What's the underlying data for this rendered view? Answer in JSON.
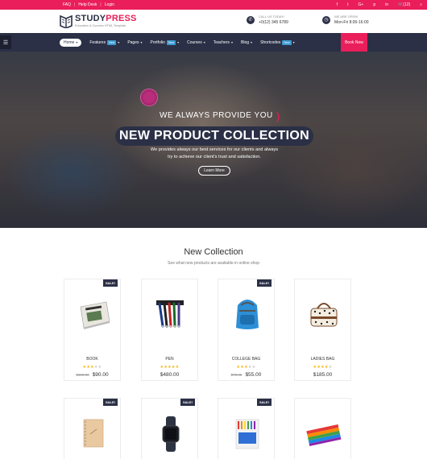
{
  "topbar": {
    "links": [
      "FAQ",
      "Help Desk",
      "Login"
    ],
    "social_icons": [
      "facebook-icon",
      "twitter-icon",
      "google-plus-icon",
      "pinterest-icon",
      "linkedin-icon",
      "cart-icon",
      "search-icon"
    ],
    "cart_count": "(12)"
  },
  "header": {
    "logo_study": "STUDY",
    "logo_press": "PRESS",
    "logo_tagline": "Education & Courses HTML Template",
    "contact_call_label": "CALL US TODAY!",
    "contact_call_value": "+0(12) 345 6789",
    "contact_open_label": "WE ARE OPEN!",
    "contact_open_value": "Mon-Fri 8:00-16:00"
  },
  "nav": {
    "items": [
      {
        "label": "Home",
        "badge": "",
        "caret": "▾"
      },
      {
        "label": "Features",
        "badge": "New",
        "caret": "▾"
      },
      {
        "label": "Pages",
        "badge": "",
        "caret": "▾"
      },
      {
        "label": "Portfolio",
        "badge": "New",
        "caret": "▾"
      },
      {
        "label": "Courses",
        "badge": "",
        "caret": "▾"
      },
      {
        "label": "Teachers",
        "badge": "",
        "caret": "▾"
      },
      {
        "label": "Blog",
        "badge": "",
        "caret": "▾"
      },
      {
        "label": "Shortcodes",
        "badge": "New",
        "caret": "▾"
      }
    ],
    "book_now": "Book Now"
  },
  "hero": {
    "subtitle": "WE ALWAYS PROVIDE YOU",
    "title": "NEW PRODUCT COLLECTION",
    "text_line1": "We provides always our best services for our clients and always",
    "text_line2": "try to achieve our client's trust and satisfaction.",
    "button": "Learn More"
  },
  "collection": {
    "title": "New Collection",
    "subtitle": "See what new products are available in online shop",
    "sale_label": "SALE!",
    "products": [
      {
        "name": "BOOK",
        "old_price": "$150.00",
        "price": "$90.00",
        "rating": 3,
        "sale": true
      },
      {
        "name": "PEN",
        "old_price": "",
        "price": "$480.00",
        "rating": 5,
        "sale": false
      },
      {
        "name": "COLLEGE BAG",
        "old_price": "$70.00",
        "price": "$55.00",
        "rating": 3,
        "sale": true
      },
      {
        "name": "LADIES BAG",
        "old_price": "",
        "price": "$185.00",
        "rating": 4,
        "sale": false
      }
    ],
    "row2_sale": [
      true,
      true,
      true,
      false
    ]
  },
  "colors": {
    "accent": "#e91e5a",
    "navy": "#2b3046",
    "star": "#f5b50a"
  }
}
